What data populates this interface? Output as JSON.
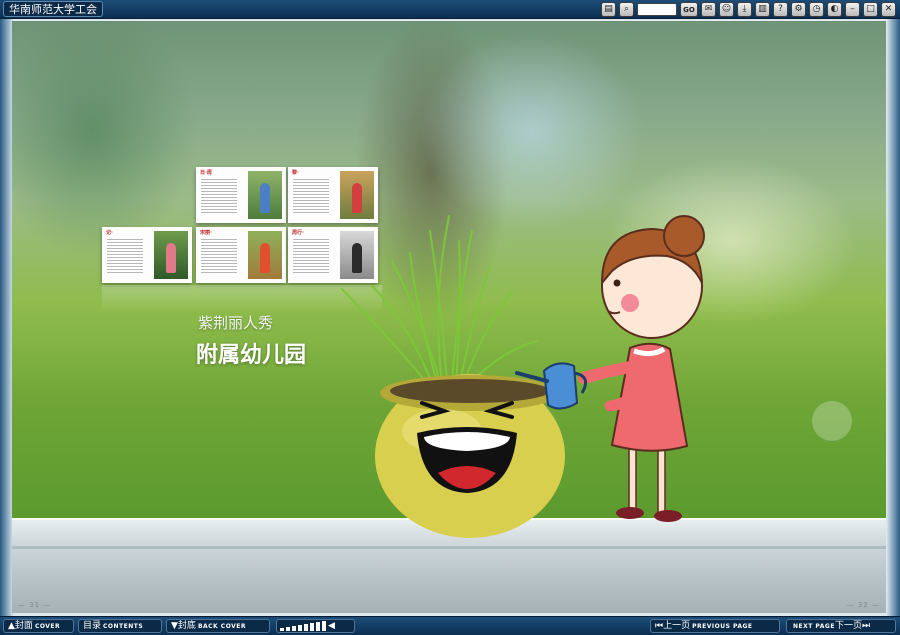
{
  "app": {
    "title": "华南师范大学工会"
  },
  "toolbar": {
    "buttons": [
      {
        "name": "bookmark-icon",
        "glyph": "▤"
      },
      {
        "name": "zoom-icon",
        "glyph": "⌕"
      }
    ],
    "page_input_value": "",
    "go_label": "GO",
    "right_buttons": [
      {
        "name": "share-icon",
        "glyph": "✉"
      },
      {
        "name": "user-icon",
        "glyph": "☺"
      },
      {
        "name": "download-icon",
        "glyph": "⤓"
      },
      {
        "name": "print-icon",
        "glyph": "▥"
      },
      {
        "name": "help-icon",
        "glyph": "?"
      },
      {
        "name": "settings-icon",
        "glyph": "⚙"
      },
      {
        "name": "clock-icon",
        "glyph": "◷"
      },
      {
        "name": "sound-icon",
        "glyph": "◐"
      },
      {
        "name": "minimize-icon",
        "glyph": "–"
      },
      {
        "name": "maximize-icon",
        "glyph": "□"
      },
      {
        "name": "close-icon",
        "glyph": "✕"
      }
    ]
  },
  "page": {
    "subtitle": "紫荆丽人秀",
    "title": "附属幼儿园",
    "left_page_number": "— 31 —",
    "right_page_number": "— 32 —",
    "thumbnails": [
      {
        "heading": "日·周"
      },
      {
        "heading": "黎·"
      },
      {
        "heading": "记·"
      },
      {
        "heading": "宋丽·"
      },
      {
        "heading": "周行·"
      }
    ]
  },
  "bottombar": {
    "cover_label": "封面",
    "cover_en": "COVER",
    "contents_label": "目录",
    "contents_en": "CONTENTS",
    "back_cover_label": "封底",
    "back_cover_en": "BACK COVER",
    "prev_label": "上一页",
    "prev_en": "PREVIOUS PAGE",
    "next_en": "NEXT PAGE",
    "next_label": "下一页"
  },
  "colors": {
    "bar": "#0c2f52",
    "accent": "#ffffff"
  }
}
